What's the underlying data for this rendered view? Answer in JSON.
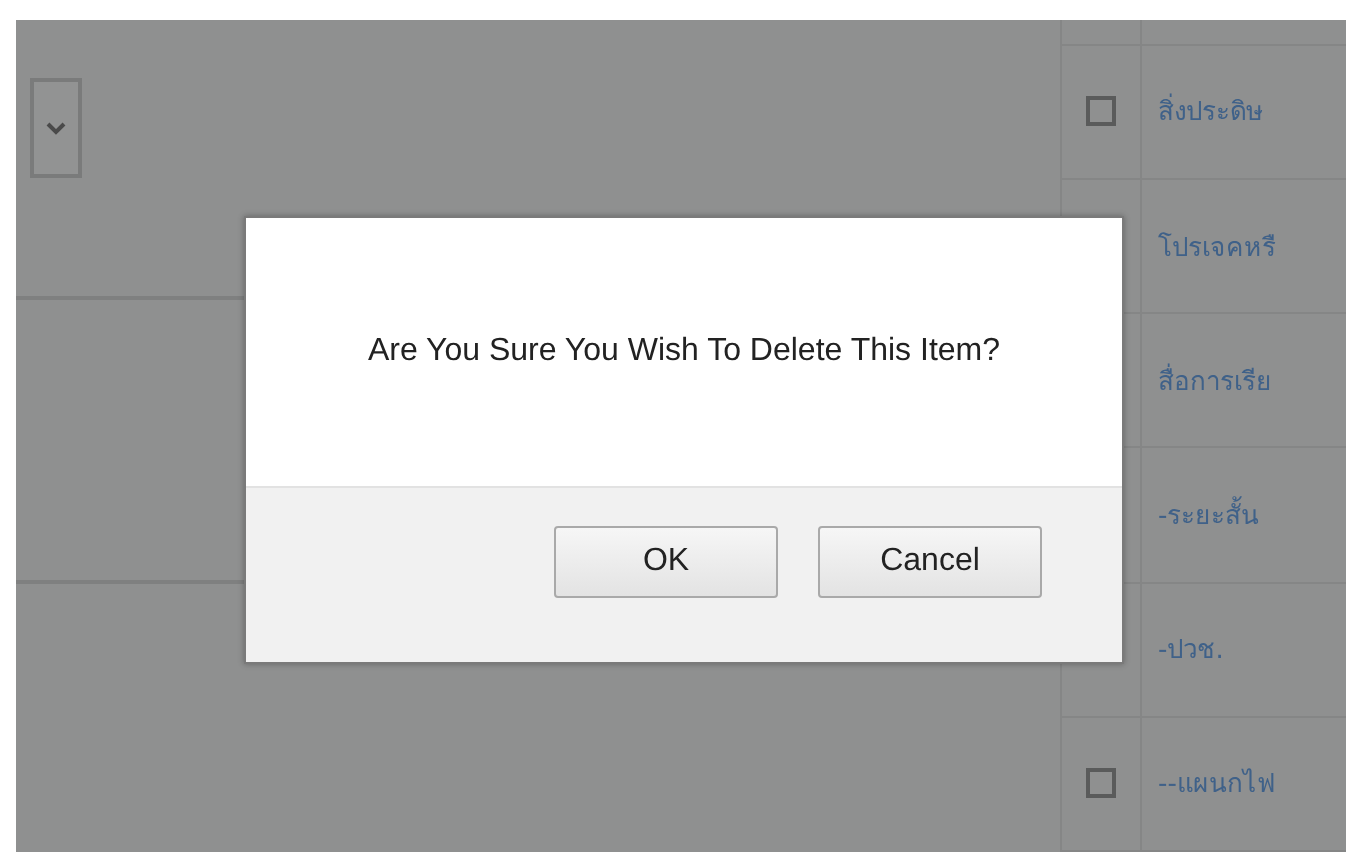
{
  "table": {
    "rows": [
      {
        "label": "สิ่งประดิษ",
        "checked": false
      },
      {
        "label": "โปรเจคหรื"
      },
      {
        "label": "สื่อการเรีย"
      },
      {
        "label": "-ระยะสั้น"
      },
      {
        "label": "-ปวช."
      },
      {
        "label": "--แผนกไฟ",
        "checked": false
      }
    ]
  },
  "dialog": {
    "message": "Are You Sure You Wish To Delete This Item?",
    "buttons": [
      "OK",
      "Cancel"
    ]
  }
}
